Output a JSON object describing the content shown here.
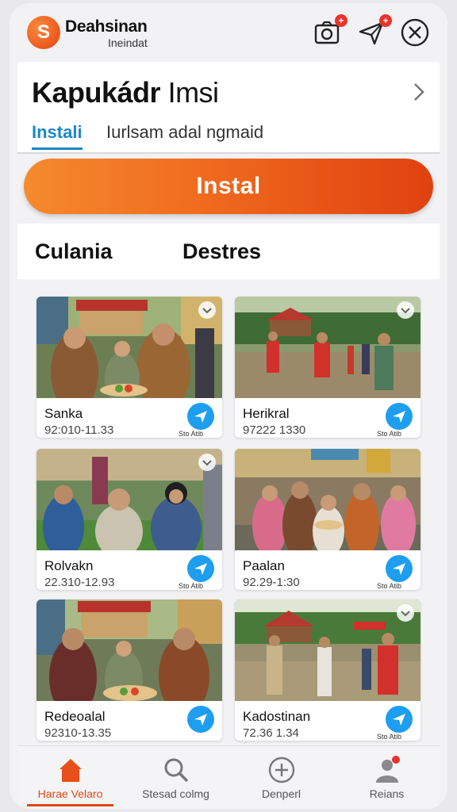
{
  "app": {
    "logo_letter": "S",
    "brand_title": "Deahsinan",
    "brand_subtitle": "Ineindat",
    "accent_color": "#e8501a",
    "link_color": "#1a87c9"
  },
  "header": {
    "title_bold": "Kapukádr",
    "title_light": "Imsi",
    "tabs": [
      {
        "label": "Instali",
        "active": true
      },
      {
        "label": "Iurlsam adal  ngmaid",
        "active": false
      }
    ]
  },
  "install_button": {
    "label": "Instal"
  },
  "section": {
    "labels": [
      "Culania",
      "Destres"
    ]
  },
  "cards": [
    {
      "name": "Sanka",
      "range": "92:010-11.33",
      "path_label": "Sto Atib",
      "checked": true
    },
    {
      "name": "Herikral",
      "range": "97222 1330",
      "path_label": "Sto Atib",
      "checked": true
    },
    {
      "name": "Rolvakn",
      "range": "22.310-12.93",
      "path_label": "Sto Atib",
      "checked": true
    },
    {
      "name": "Paalan",
      "range": "92.29-1:30",
      "path_label": "Sto Atib",
      "checked": false
    },
    {
      "name": "Redeoalal",
      "range": "92310-13.35",
      "path_label": "",
      "checked": false
    },
    {
      "name": "Kadostinan",
      "range": "72.36 1.34",
      "path_label": "Sto Atib",
      "checked": true
    }
  ],
  "bottom_nav": [
    {
      "label": "Harae Velaro",
      "icon": "home-icon",
      "active": true
    },
    {
      "label": "Stesad colmg",
      "icon": "search-icon",
      "active": false
    },
    {
      "label": "Denperl",
      "icon": "plus-circle-icon",
      "active": false
    },
    {
      "label": "Reians",
      "icon": "profile-icon",
      "active": false,
      "badge": true
    }
  ]
}
